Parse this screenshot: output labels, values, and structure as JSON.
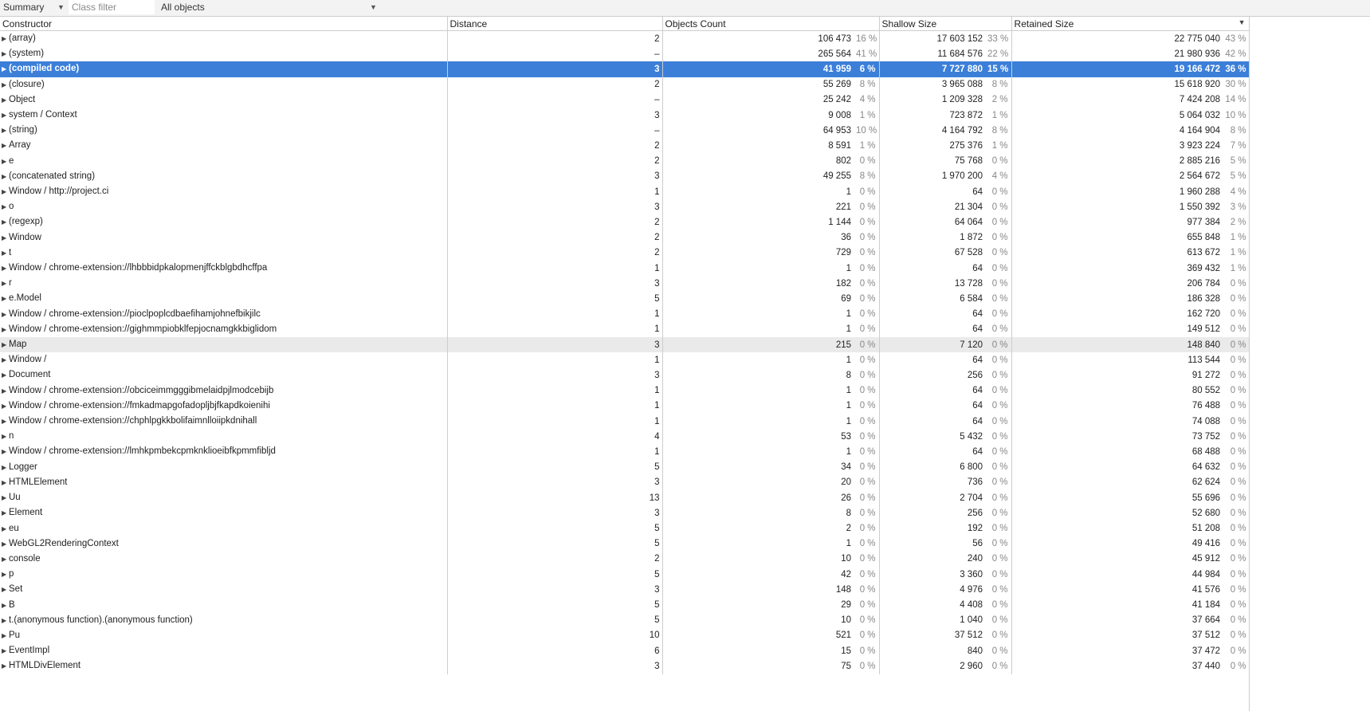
{
  "toolbar": {
    "view_label": "Summary",
    "class_filter_placeholder": "Class filter",
    "objects_label": "All objects"
  },
  "columns": {
    "constructor": "Constructor",
    "distance": "Distance",
    "objects_count": "Objects Count",
    "shallow_size": "Shallow Size",
    "retained_size": "Retained Size"
  },
  "rows": [
    {
      "name": "(array)",
      "distance": "2",
      "count": "106 473",
      "count_pct": "16 %",
      "shallow": "17 603 152",
      "shallow_pct": "33 %",
      "retained": "22 775 040",
      "retained_pct": "43 %"
    },
    {
      "name": "(system)",
      "distance": "–",
      "count": "265 564",
      "count_pct": "41 %",
      "shallow": "11 684 576",
      "shallow_pct": "22 %",
      "retained": "21 980 936",
      "retained_pct": "42 %"
    },
    {
      "name": "(compiled code)",
      "distance": "3",
      "count": "41 959",
      "count_pct": "6 %",
      "shallow": "7 727 880",
      "shallow_pct": "15 %",
      "retained": "19 166 472",
      "retained_pct": "36 %"
    },
    {
      "name": "(closure)",
      "distance": "2",
      "count": "55 269",
      "count_pct": "8 %",
      "shallow": "3 965 088",
      "shallow_pct": "8 %",
      "retained": "15 618 920",
      "retained_pct": "30 %"
    },
    {
      "name": "Object",
      "distance": "–",
      "count": "25 242",
      "count_pct": "4 %",
      "shallow": "1 209 328",
      "shallow_pct": "2 %",
      "retained": "7 424 208",
      "retained_pct": "14 %"
    },
    {
      "name": "system / Context",
      "distance": "3",
      "count": "9 008",
      "count_pct": "1 %",
      "shallow": "723 872",
      "shallow_pct": "1 %",
      "retained": "5 064 032",
      "retained_pct": "10 %"
    },
    {
      "name": "(string)",
      "distance": "–",
      "count": "64 953",
      "count_pct": "10 %",
      "shallow": "4 164 792",
      "shallow_pct": "8 %",
      "retained": "4 164 904",
      "retained_pct": "8 %"
    },
    {
      "name": "Array",
      "distance": "2",
      "count": "8 591",
      "count_pct": "1 %",
      "shallow": "275 376",
      "shallow_pct": "1 %",
      "retained": "3 923 224",
      "retained_pct": "7 %"
    },
    {
      "name": "e",
      "distance": "2",
      "count": "802",
      "count_pct": "0 %",
      "shallow": "75 768",
      "shallow_pct": "0 %",
      "retained": "2 885 216",
      "retained_pct": "5 %"
    },
    {
      "name": "(concatenated string)",
      "distance": "3",
      "count": "49 255",
      "count_pct": "8 %",
      "shallow": "1 970 200",
      "shallow_pct": "4 %",
      "retained": "2 564 672",
      "retained_pct": "5 %"
    },
    {
      "name": "Window / http://project.ci",
      "distance": "1",
      "count": "1",
      "count_pct": "0 %",
      "shallow": "64",
      "shallow_pct": "0 %",
      "retained": "1 960 288",
      "retained_pct": "4 %"
    },
    {
      "name": "o",
      "distance": "3",
      "count": "221",
      "count_pct": "0 %",
      "shallow": "21 304",
      "shallow_pct": "0 %",
      "retained": "1 550 392",
      "retained_pct": "3 %"
    },
    {
      "name": "(regexp)",
      "distance": "2",
      "count": "1 144",
      "count_pct": "0 %",
      "shallow": "64 064",
      "shallow_pct": "0 %",
      "retained": "977 384",
      "retained_pct": "2 %"
    },
    {
      "name": "Window",
      "distance": "2",
      "count": "36",
      "count_pct": "0 %",
      "shallow": "1 872",
      "shallow_pct": "0 %",
      "retained": "655 848",
      "retained_pct": "1 %"
    },
    {
      "name": "t",
      "distance": "2",
      "count": "729",
      "count_pct": "0 %",
      "shallow": "67 528",
      "shallow_pct": "0 %",
      "retained": "613 672",
      "retained_pct": "1 %"
    },
    {
      "name": "Window / chrome-extension://lhbbbidpkalopmenjffckblgbdhcffpa",
      "distance": "1",
      "count": "1",
      "count_pct": "0 %",
      "shallow": "64",
      "shallow_pct": "0 %",
      "retained": "369 432",
      "retained_pct": "1 %"
    },
    {
      "name": "r",
      "distance": "3",
      "count": "182",
      "count_pct": "0 %",
      "shallow": "13 728",
      "shallow_pct": "0 %",
      "retained": "206 784",
      "retained_pct": "0 %"
    },
    {
      "name": "e.Model",
      "distance": "5",
      "count": "69",
      "count_pct": "0 %",
      "shallow": "6 584",
      "shallow_pct": "0 %",
      "retained": "186 328",
      "retained_pct": "0 %"
    },
    {
      "name": "Window / chrome-extension://pioclpoplcdbaefihamjohnefbikjilc",
      "distance": "1",
      "count": "1",
      "count_pct": "0 %",
      "shallow": "64",
      "shallow_pct": "0 %",
      "retained": "162 720",
      "retained_pct": "0 %"
    },
    {
      "name": "Window / chrome-extension://gighmmpiobklfepjocnamgkkbiglidom",
      "distance": "1",
      "count": "1",
      "count_pct": "0 %",
      "shallow": "64",
      "shallow_pct": "0 %",
      "retained": "149 512",
      "retained_pct": "0 %"
    },
    {
      "name": "Map",
      "distance": "3",
      "count": "215",
      "count_pct": "0 %",
      "shallow": "7 120",
      "shallow_pct": "0 %",
      "retained": "148 840",
      "retained_pct": "0 %"
    },
    {
      "name": "Window /",
      "distance": "1",
      "count": "1",
      "count_pct": "0 %",
      "shallow": "64",
      "shallow_pct": "0 %",
      "retained": "113 544",
      "retained_pct": "0 %"
    },
    {
      "name": "Document",
      "distance": "3",
      "count": "8",
      "count_pct": "0 %",
      "shallow": "256",
      "shallow_pct": "0 %",
      "retained": "91 272",
      "retained_pct": "0 %"
    },
    {
      "name": "Window / chrome-extension://obciceimmgggibmelaidpjlmodcebijb",
      "distance": "1",
      "count": "1",
      "count_pct": "0 %",
      "shallow": "64",
      "shallow_pct": "0 %",
      "retained": "80 552",
      "retained_pct": "0 %"
    },
    {
      "name": "Window / chrome-extension://fmkadmapgofadopljbjfkapdkoienihi",
      "distance": "1",
      "count": "1",
      "count_pct": "0 %",
      "shallow": "64",
      "shallow_pct": "0 %",
      "retained": "76 488",
      "retained_pct": "0 %"
    },
    {
      "name": "Window / chrome-extension://chphlpgkkbolifaimnlloiipkdnihall",
      "distance": "1",
      "count": "1",
      "count_pct": "0 %",
      "shallow": "64",
      "shallow_pct": "0 %",
      "retained": "74 088",
      "retained_pct": "0 %"
    },
    {
      "name": "n",
      "distance": "4",
      "count": "53",
      "count_pct": "0 %",
      "shallow": "5 432",
      "shallow_pct": "0 %",
      "retained": "73 752",
      "retained_pct": "0 %"
    },
    {
      "name": "Window / chrome-extension://lmhkpmbekcpmknklioeibfkpmmfibljd",
      "distance": "1",
      "count": "1",
      "count_pct": "0 %",
      "shallow": "64",
      "shallow_pct": "0 %",
      "retained": "68 488",
      "retained_pct": "0 %"
    },
    {
      "name": "Logger",
      "distance": "5",
      "count": "34",
      "count_pct": "0 %",
      "shallow": "6 800",
      "shallow_pct": "0 %",
      "retained": "64 632",
      "retained_pct": "0 %"
    },
    {
      "name": "HTMLElement",
      "distance": "3",
      "count": "20",
      "count_pct": "0 %",
      "shallow": "736",
      "shallow_pct": "0 %",
      "retained": "62 624",
      "retained_pct": "0 %"
    },
    {
      "name": "Uu",
      "distance": "13",
      "count": "26",
      "count_pct": "0 %",
      "shallow": "2 704",
      "shallow_pct": "0 %",
      "retained": "55 696",
      "retained_pct": "0 %"
    },
    {
      "name": "Element",
      "distance": "3",
      "count": "8",
      "count_pct": "0 %",
      "shallow": "256",
      "shallow_pct": "0 %",
      "retained": "52 680",
      "retained_pct": "0 %"
    },
    {
      "name": "eu",
      "distance": "5",
      "count": "2",
      "count_pct": "0 %",
      "shallow": "192",
      "shallow_pct": "0 %",
      "retained": "51 208",
      "retained_pct": "0 %"
    },
    {
      "name": "WebGL2RenderingContext",
      "distance": "5",
      "count": "1",
      "count_pct": "0 %",
      "shallow": "56",
      "shallow_pct": "0 %",
      "retained": "49 416",
      "retained_pct": "0 %"
    },
    {
      "name": "console",
      "distance": "2",
      "count": "10",
      "count_pct": "0 %",
      "shallow": "240",
      "shallow_pct": "0 %",
      "retained": "45 912",
      "retained_pct": "0 %"
    },
    {
      "name": "p",
      "distance": "5",
      "count": "42",
      "count_pct": "0 %",
      "shallow": "3 360",
      "shallow_pct": "0 %",
      "retained": "44 984",
      "retained_pct": "0 %"
    },
    {
      "name": "Set",
      "distance": "3",
      "count": "148",
      "count_pct": "0 %",
      "shallow": "4 976",
      "shallow_pct": "0 %",
      "retained": "41 576",
      "retained_pct": "0 %"
    },
    {
      "name": "B",
      "distance": "5",
      "count": "29",
      "count_pct": "0 %",
      "shallow": "4 408",
      "shallow_pct": "0 %",
      "retained": "41 184",
      "retained_pct": "0 %"
    },
    {
      "name": "t.(anonymous function).(anonymous function)",
      "distance": "5",
      "count": "10",
      "count_pct": "0 %",
      "shallow": "1 040",
      "shallow_pct": "0 %",
      "retained": "37 664",
      "retained_pct": "0 %"
    },
    {
      "name": "Pu",
      "distance": "10",
      "count": "521",
      "count_pct": "0 %",
      "shallow": "37 512",
      "shallow_pct": "0 %",
      "retained": "37 512",
      "retained_pct": "0 %"
    },
    {
      "name": "EventImpl",
      "distance": "6",
      "count": "15",
      "count_pct": "0 %",
      "shallow": "840",
      "shallow_pct": "0 %",
      "retained": "37 472",
      "retained_pct": "0 %"
    },
    {
      "name": "HTMLDivElement",
      "distance": "3",
      "count": "75",
      "count_pct": "0 %",
      "shallow": "2 960",
      "shallow_pct": "0 %",
      "retained": "37 440",
      "retained_pct": "0 %"
    }
  ],
  "selected_row": 2,
  "hovered_row": 20
}
